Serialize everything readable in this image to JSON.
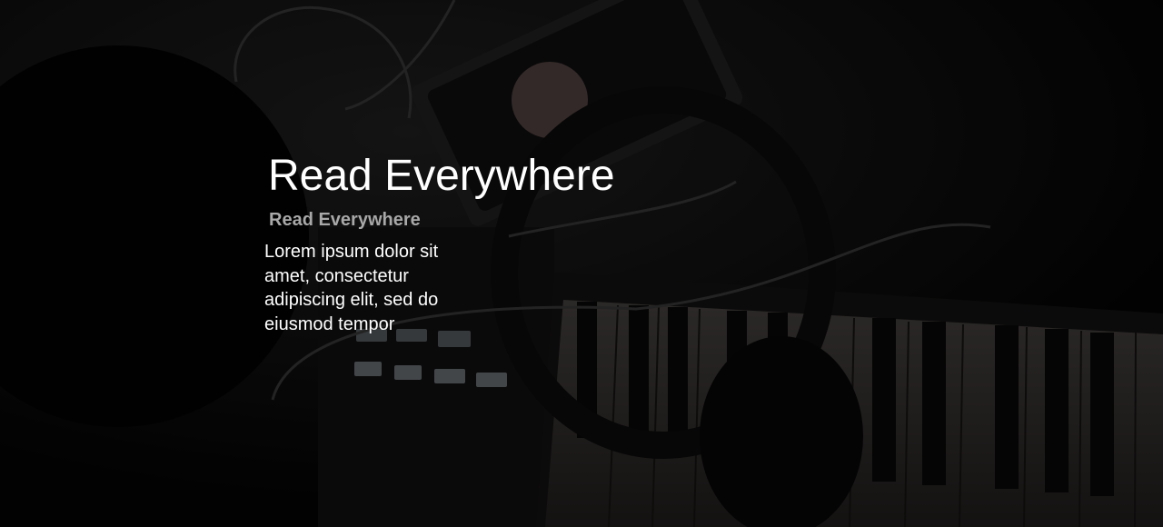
{
  "hero": {
    "title": "Read Everywhere",
    "subtitle": "Read Everywhere",
    "body": "Lorem ipsum dolor sit amet, consectetur adipiscing elit, sed do eiusmod tempor",
    "background_image": "dark-studio-photo-audio-interface-keyboard-headphones",
    "colors": {
      "title": "#ffffff",
      "subtitle": "#a8a8a8",
      "body": "#ffffff"
    }
  }
}
